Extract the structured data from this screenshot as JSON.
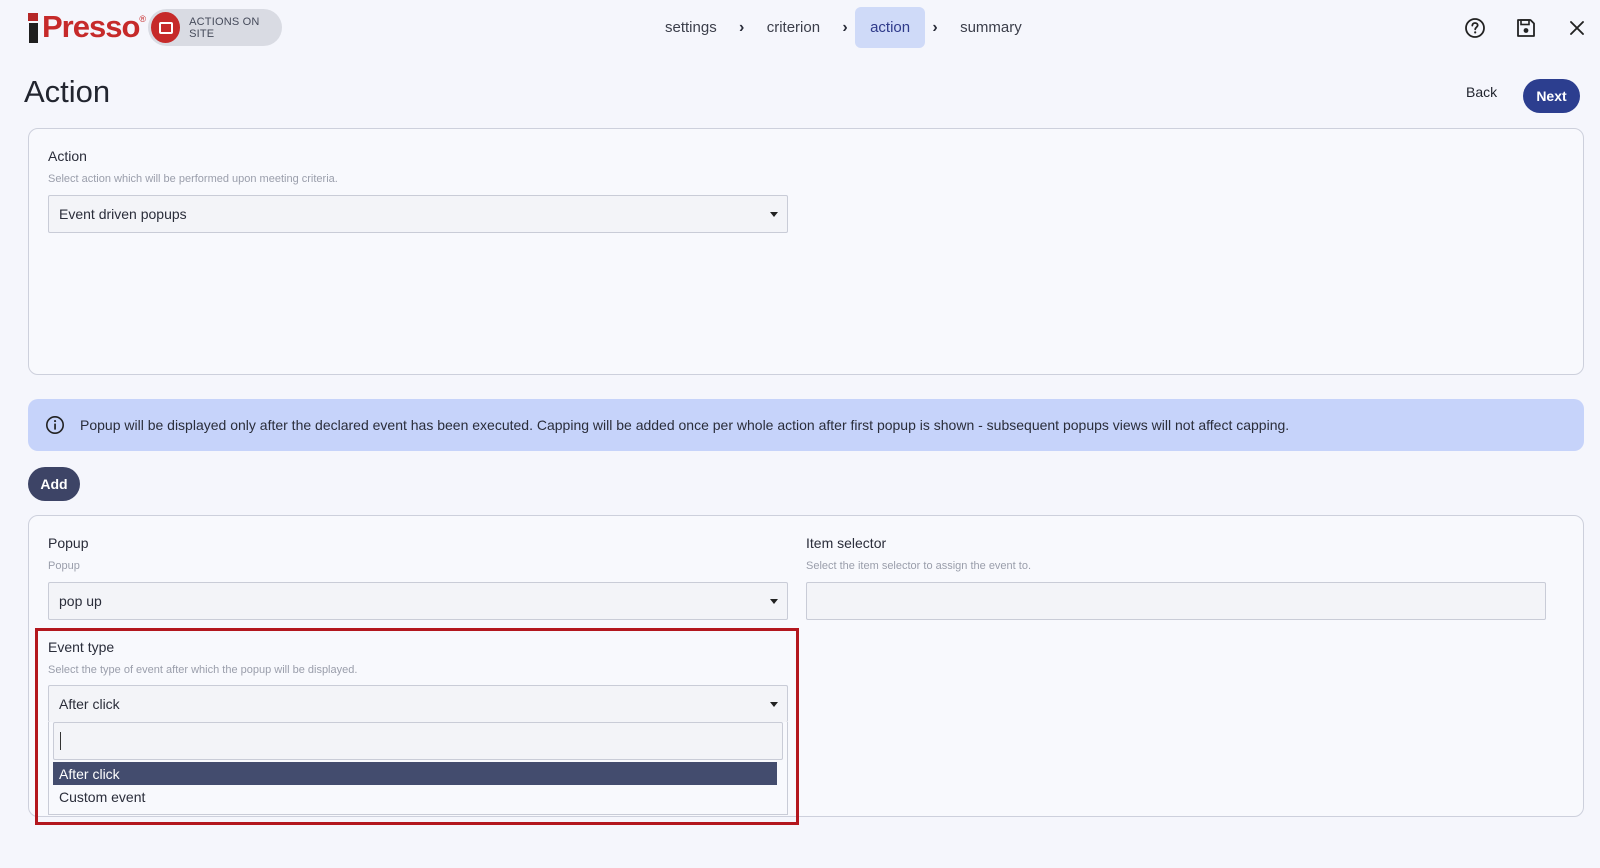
{
  "header": {
    "logo_text": "iPresso",
    "module_label": "ACTIONS ON SITE",
    "steps": [
      {
        "label": "settings"
      },
      {
        "label": "criterion"
      },
      {
        "label": "action"
      },
      {
        "label": "summary"
      }
    ],
    "active_step": "action",
    "tools": [
      "help-icon",
      "save-icon",
      "close-icon"
    ]
  },
  "page": {
    "title": "Action",
    "back_label": "Back",
    "next_label": "Next"
  },
  "action_card": {
    "label": "Action",
    "help": "Select action which will be performed upon meeting criteria.",
    "value": "Event driven popups"
  },
  "info": {
    "icon": "info-icon",
    "text": "Popup will be displayed only after the declared event has been executed. Capping will be added once per whole action after first popup is shown - subsequent popups views will not affect capping."
  },
  "add_label": "Add",
  "popup_card": {
    "popup": {
      "label": "Popup",
      "help": "Popup",
      "value": "pop up"
    },
    "item_selector": {
      "label": "Item selector",
      "help": "Select the item selector to assign the event to.",
      "value": ""
    },
    "event_type": {
      "label": "Event type",
      "help": "Select the type of event after which the popup will be displayed.",
      "value": "After click",
      "search_value": "",
      "options": [
        "After click",
        "Custom event"
      ],
      "selected_option": "After click"
    }
  },
  "colors": {
    "brand_red": "#c62a2a",
    "primary": "#2c3e8f",
    "active_step_bg": "#cfdaf8",
    "info_bg": "#c6d3fa",
    "highlight_border": "#b3171e"
  }
}
